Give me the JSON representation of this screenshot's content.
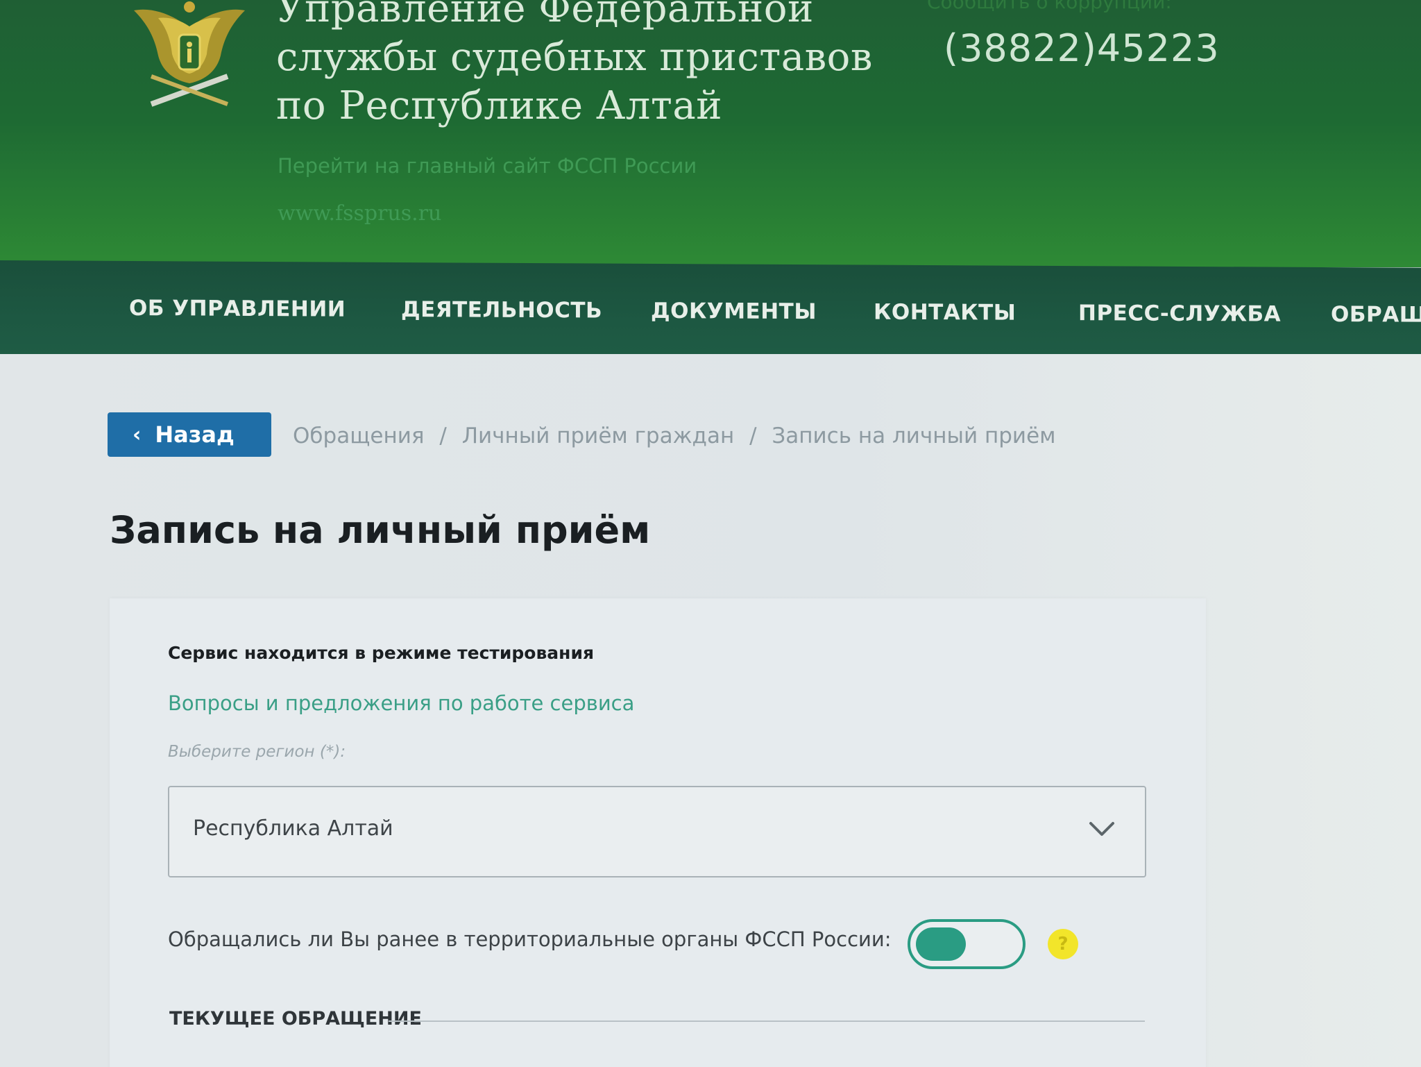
{
  "header": {
    "title_lines": [
      "Управление Федеральной",
      "службы судебных приставов",
      "по Республике Алтай"
    ],
    "main_site_link": "Перейти на главный сайт ФССП России",
    "site_url": "www.fssprus.ru",
    "corruption_link": "Сообщить о коррупции:",
    "phone": "(38822)45223"
  },
  "nav": {
    "items": [
      "ОБ УПРАВЛЕНИИ",
      "ДЕЯТЕЛЬНОСТЬ",
      "ДОКУМЕНТЫ",
      "КОНТАКТЫ",
      "ПРЕСС-СЛУЖБА",
      "ОБРАЩЕ"
    ]
  },
  "back_button": {
    "label": "Назад",
    "icon": "chevron-left-icon"
  },
  "breadcrumb": {
    "items": [
      "Обращения",
      "Личный приём граждан",
      "Запись на личный приём"
    ],
    "separator": "/"
  },
  "page_title": "Запись на личный приём",
  "form": {
    "test_notice": "Сервис находится в режиме тестирования",
    "feedback_link": "Вопросы и предложения по работе сервиса",
    "region_label": "Выберите регион (*):",
    "region_value": "Республика Алтай",
    "previous_contact_question": "Обращались ли Вы ранее в территориальные органы ФССП России:",
    "previous_contact_toggle": "off",
    "help_icon": "?",
    "section_title": "ТЕКУЩЕЕ ОБРАЩЕНИЕ"
  },
  "colors": {
    "header_green": "#1e6a33",
    "nav_dark_green": "#1d5842",
    "back_button_blue": "#1f6ea7",
    "accent_teal": "#2a9c83",
    "help_yellow": "#f2e52a"
  }
}
